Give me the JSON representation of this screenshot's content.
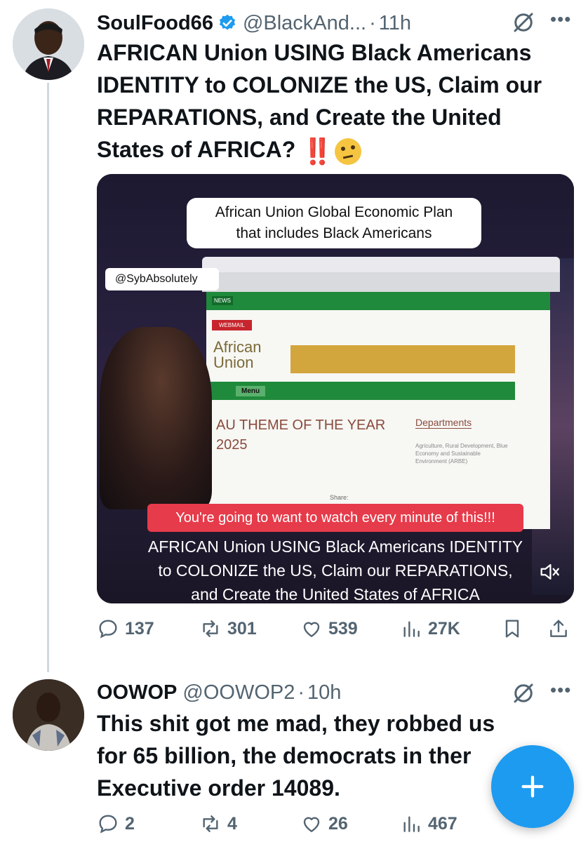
{
  "tweets": [
    {
      "display_name": "SoulFood66",
      "handle": "@BlackAnd...",
      "separator": "·",
      "time": "11h",
      "text_lines": [
        "AFRICAN Union USING Black Americans",
        "IDENTITY to COLONIZE the US, Claim our",
        "REPARATIONS, and Create the United",
        "States of AFRICA?"
      ],
      "emoji": [
        "‼️",
        "🤔"
      ],
      "media": {
        "plan_box_lines": [
          "African Union Global Economic Plan",
          "that includes Black Americans"
        ],
        "tag_handle": "@SybAbsolutely",
        "site_news": "NEWS",
        "site_webmail": "WEBMAIL",
        "site_logo_lines": [
          "African",
          "Union"
        ],
        "site_menu": "Menu",
        "au_theme_lines": [
          "AU THEME OF THE YEAR",
          "2025"
        ],
        "departments": "Departments",
        "dept_desc": "Agriculture, Rural Development, Blue Economy and Sustainable Environment (ARBE)",
        "share": "Share:",
        "red_banner": "You're going to want to watch every minute of this!!!",
        "caption_lines": [
          "AFRICAN Union USING Black Americans IDENTITY",
          "to COLONIZE the US, Claim our REPARATIONS,",
          "and Create the United States of AFRICA"
        ]
      },
      "actions": {
        "replies": "137",
        "reposts": "301",
        "likes": "539",
        "views": "27K"
      }
    },
    {
      "display_name": "OOWOP",
      "handle": "@OOWOP2",
      "separator": "·",
      "time": "10h",
      "text_lines": [
        "This shit got me mad, they robbed us",
        "for 65 billion, the democrats in ther",
        "Executive order 14089."
      ],
      "actions": {
        "replies": "2",
        "reposts": "4",
        "likes": "26",
        "views": "467"
      }
    }
  ],
  "icons": {
    "verified": "verified-badge-icon",
    "grok": "grok-icon",
    "more": "more-icon",
    "reply": "reply-icon",
    "repost": "repost-icon",
    "like": "like-icon",
    "views": "views-icon",
    "bookmark": "bookmark-icon",
    "share": "share-icon",
    "compose": "compose-plus-icon",
    "mute": "mute-icon"
  },
  "colors": {
    "accent": "#1d9bf0",
    "text": "#0f1419",
    "secondary": "#536471",
    "thread_line": "#cfd9de"
  }
}
